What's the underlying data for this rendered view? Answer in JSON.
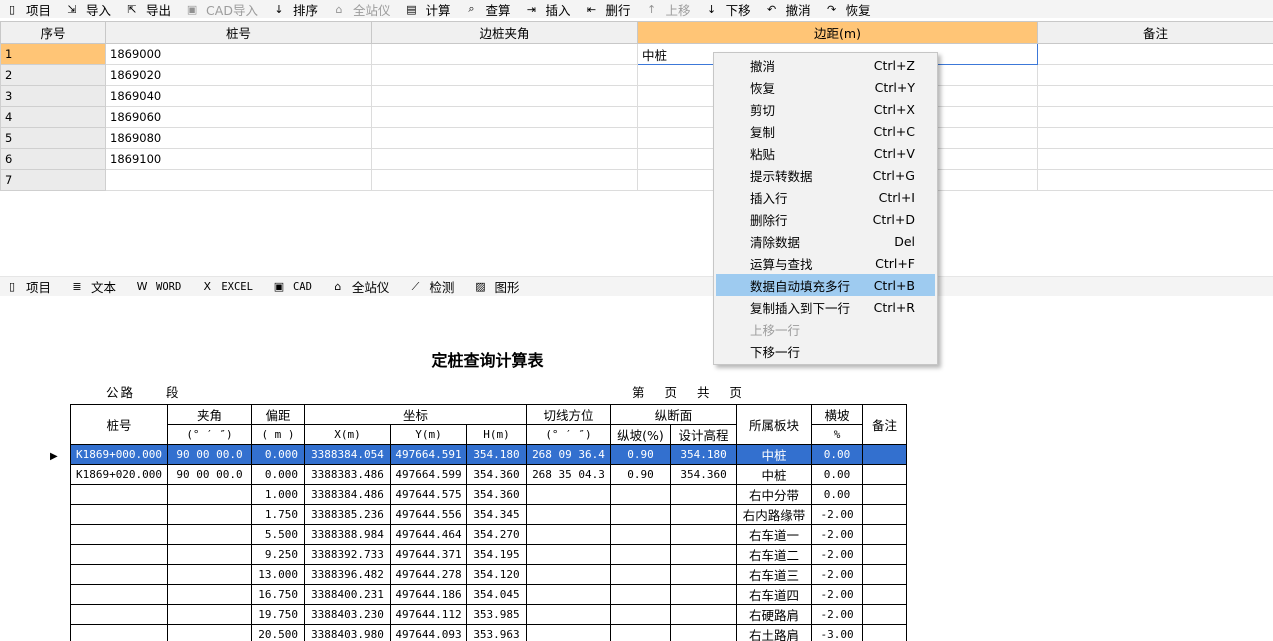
{
  "toolbar": {
    "items": [
      {
        "label": "项目",
        "icon": "document-icon",
        "glyph": "▯",
        "enabled": true
      },
      {
        "label": "导入",
        "icon": "import-icon",
        "glyph": "⇲",
        "enabled": true
      },
      {
        "label": "导出",
        "icon": "export-icon",
        "glyph": "⇱",
        "enabled": true
      },
      {
        "label": "CAD导入",
        "icon": "cad-import-icon",
        "glyph": "▣",
        "enabled": false
      },
      {
        "label": "排序",
        "icon": "sort-az-icon",
        "glyph": "↓",
        "enabled": true
      },
      {
        "label": "全站仪",
        "icon": "total-station-icon",
        "glyph": "⌂",
        "enabled": false
      },
      {
        "label": "计算",
        "icon": "calculator-icon",
        "glyph": "▤",
        "enabled": true
      },
      {
        "label": "查算",
        "icon": "search-icon",
        "glyph": "⌕",
        "enabled": true
      },
      {
        "label": "插入",
        "icon": "insert-row-icon",
        "glyph": "⇥",
        "enabled": true
      },
      {
        "label": "删行",
        "icon": "delete-row-icon",
        "glyph": "⇤",
        "enabled": true
      },
      {
        "label": "上移",
        "icon": "arrow-up-icon",
        "glyph": "↑",
        "enabled": false
      },
      {
        "label": "下移",
        "icon": "arrow-down-icon",
        "glyph": "↓",
        "enabled": true
      },
      {
        "label": "撤消",
        "icon": "undo-icon",
        "glyph": "↶",
        "enabled": true
      },
      {
        "label": "恢复",
        "icon": "redo-icon",
        "glyph": "↷",
        "enabled": true
      }
    ]
  },
  "grid": {
    "columns": [
      "序号",
      "桩号",
      "边桩夹角",
      "边距(m)",
      "备注"
    ],
    "selected_column": 3,
    "rows": [
      {
        "idx": "1",
        "stake": "1869000",
        "angle": "",
        "offset": "中桩",
        "note": ""
      },
      {
        "idx": "2",
        "stake": "1869020",
        "angle": "",
        "offset": "",
        "note": ""
      },
      {
        "idx": "3",
        "stake": "1869040",
        "angle": "",
        "offset": "",
        "note": ""
      },
      {
        "idx": "4",
        "stake": "1869060",
        "angle": "",
        "offset": "",
        "note": ""
      },
      {
        "idx": "5",
        "stake": "1869080",
        "angle": "",
        "offset": "",
        "note": ""
      },
      {
        "idx": "6",
        "stake": "1869100",
        "angle": "",
        "offset": "",
        "note": ""
      },
      {
        "idx": "7",
        "stake": "",
        "angle": "",
        "offset": "",
        "note": ""
      }
    ]
  },
  "toolbar2": {
    "items": [
      {
        "label": "项目",
        "icon": "document-icon",
        "glyph": "▯",
        "mono": false
      },
      {
        "label": "文本",
        "icon": "text-file-icon",
        "glyph": "≣",
        "mono": false
      },
      {
        "label": "WORD",
        "icon": "word-icon",
        "glyph": "W",
        "mono": true
      },
      {
        "label": "EXCEL",
        "icon": "excel-icon",
        "glyph": "X",
        "mono": true
      },
      {
        "label": "CAD",
        "icon": "cad-icon",
        "glyph": "▣",
        "mono": true
      },
      {
        "label": "全站仪",
        "icon": "total-station-icon",
        "glyph": "⌂",
        "mono": false
      },
      {
        "label": "检测",
        "icon": "chart-check-icon",
        "glyph": "⟋",
        "mono": false
      },
      {
        "label": "图形",
        "icon": "image-icon",
        "glyph": "▨",
        "mono": false
      }
    ]
  },
  "report": {
    "title": "定桩查询计算表",
    "road_label": "公路",
    "section_label": "段",
    "page_label": "第 页 共 页",
    "headers": {
      "stake": "桩号",
      "angle": "夹角",
      "angle_unit": "(° ′ ″)",
      "offset": "偏距",
      "offset_unit": "( m )",
      "coord": "坐标",
      "x": "X(m)",
      "y": "Y(m)",
      "h": "H(m)",
      "tangent": "切线方位",
      "tangent_unit": "(° ′ ″)",
      "profile": "纵断面",
      "grade": "纵坡(%)",
      "design_elev": "设计高程",
      "block": "所属板块",
      "cross_slope": "横坡",
      "cross_slope_unit": "%",
      "note": "备注"
    },
    "rows": [
      {
        "stake": "K1869+000.000",
        "angle": "90 00 00.0",
        "offset": "0.000",
        "x": "3388384.054",
        "y": "497664.591",
        "h": "354.180",
        "tangent": "268 09 36.4",
        "grade": "0.90",
        "elev": "354.180",
        "block": "中桩",
        "slope": "0.00",
        "note": "",
        "highlight": true
      },
      {
        "stake": "K1869+020.000",
        "angle": "90 00 00.0",
        "offset": "0.000",
        "x": "3388383.486",
        "y": "497664.599",
        "h": "354.360",
        "tangent": "268 35 04.3",
        "grade": "0.90",
        "elev": "354.360",
        "block": "中桩",
        "slope": "0.00",
        "note": "",
        "highlight": false
      },
      {
        "stake": "",
        "angle": "",
        "offset": "1.000",
        "x": "3388384.486",
        "y": "497644.575",
        "h": "354.360",
        "tangent": "",
        "grade": "",
        "elev": "",
        "block": "右中分带",
        "slope": "0.00",
        "note": "",
        "highlight": false
      },
      {
        "stake": "",
        "angle": "",
        "offset": "1.750",
        "x": "3388385.236",
        "y": "497644.556",
        "h": "354.345",
        "tangent": "",
        "grade": "",
        "elev": "",
        "block": "右内路缘带",
        "slope": "-2.00",
        "note": "",
        "highlight": false
      },
      {
        "stake": "",
        "angle": "",
        "offset": "5.500",
        "x": "3388388.984",
        "y": "497644.464",
        "h": "354.270",
        "tangent": "",
        "grade": "",
        "elev": "",
        "block": "右车道一",
        "slope": "-2.00",
        "note": "",
        "highlight": false
      },
      {
        "stake": "",
        "angle": "",
        "offset": "9.250",
        "x": "3388392.733",
        "y": "497644.371",
        "h": "354.195",
        "tangent": "",
        "grade": "",
        "elev": "",
        "block": "右车道二",
        "slope": "-2.00",
        "note": "",
        "highlight": false
      },
      {
        "stake": "",
        "angle": "",
        "offset": "13.000",
        "x": "3388396.482",
        "y": "497644.278",
        "h": "354.120",
        "tangent": "",
        "grade": "",
        "elev": "",
        "block": "右车道三",
        "slope": "-2.00",
        "note": "",
        "highlight": false
      },
      {
        "stake": "",
        "angle": "",
        "offset": "16.750",
        "x": "3388400.231",
        "y": "497644.186",
        "h": "354.045",
        "tangent": "",
        "grade": "",
        "elev": "",
        "block": "右车道四",
        "slope": "-2.00",
        "note": "",
        "highlight": false
      },
      {
        "stake": "",
        "angle": "",
        "offset": "19.750",
        "x": "3388403.230",
        "y": "497644.112",
        "h": "353.985",
        "tangent": "",
        "grade": "",
        "elev": "",
        "block": "右硬路肩",
        "slope": "-2.00",
        "note": "",
        "highlight": false
      },
      {
        "stake": "",
        "angle": "",
        "offset": "20.500",
        "x": "3388403.980",
        "y": "497644.093",
        "h": "353.963",
        "tangent": "",
        "grade": "",
        "elev": "",
        "block": "右土路肩",
        "slope": "-3.00",
        "note": "",
        "highlight": false
      }
    ]
  },
  "context_menu": {
    "items": [
      {
        "label": "撤消",
        "shortcut": "Ctrl+Z",
        "enabled": true,
        "hover": false
      },
      {
        "label": "恢复",
        "shortcut": "Ctrl+Y",
        "enabled": true,
        "hover": false
      },
      {
        "label": "剪切",
        "shortcut": "Ctrl+X",
        "enabled": true,
        "hover": false
      },
      {
        "label": "复制",
        "shortcut": "Ctrl+C",
        "enabled": true,
        "hover": false
      },
      {
        "label": "粘贴",
        "shortcut": "Ctrl+V",
        "enabled": true,
        "hover": false
      },
      {
        "label": "提示转数据",
        "shortcut": "Ctrl+G",
        "enabled": true,
        "hover": false
      },
      {
        "label": "插入行",
        "shortcut": "Ctrl+I",
        "enabled": true,
        "hover": false
      },
      {
        "label": "删除行",
        "shortcut": "Ctrl+D",
        "enabled": true,
        "hover": false
      },
      {
        "label": "清除数据",
        "shortcut": "Del",
        "enabled": true,
        "hover": false
      },
      {
        "label": "运算与查找",
        "shortcut": "Ctrl+F",
        "enabled": true,
        "hover": false
      },
      {
        "label": "数据自动填充多行",
        "shortcut": "Ctrl+B",
        "enabled": true,
        "hover": true
      },
      {
        "label": "复制插入到下一行",
        "shortcut": "Ctrl+R",
        "enabled": true,
        "hover": false
      },
      {
        "label": "上移一行",
        "shortcut": "",
        "enabled": false,
        "hover": false
      },
      {
        "label": "下移一行",
        "shortcut": "",
        "enabled": true,
        "hover": false
      }
    ]
  },
  "colors": {
    "selected_header": "#ffc576",
    "highlight_row": "#3370cf",
    "menu_hover": "#9ecbf0"
  }
}
